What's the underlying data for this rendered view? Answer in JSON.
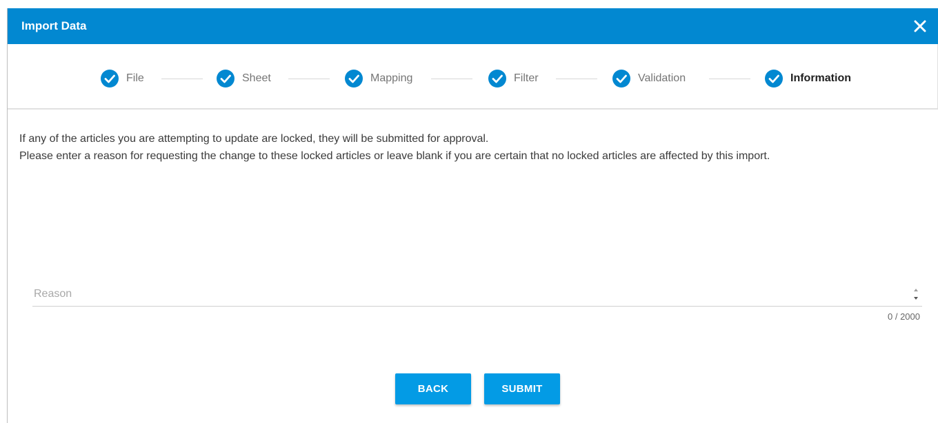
{
  "dialog": {
    "title": "Import Data"
  },
  "steps": [
    {
      "label": "File",
      "icon": "check-circle-icon",
      "state": "completed"
    },
    {
      "label": "Sheet",
      "icon": "check-circle-icon",
      "state": "completed"
    },
    {
      "label": "Mapping",
      "icon": "check-circle-icon",
      "state": "completed"
    },
    {
      "label": "Filter",
      "icon": "check-circle-icon",
      "state": "completed"
    },
    {
      "label": "Validation",
      "icon": "check-circle-icon",
      "state": "completed"
    },
    {
      "label": "Information",
      "icon": "check-circle-icon",
      "state": "active"
    }
  ],
  "content": {
    "line1": "If any of the articles you are attempting to update are locked, they will be submitted for approval.",
    "line2": "Please enter a reason for requesting the change to these locked articles or leave blank if you are certain that no locked articles are affected by this import."
  },
  "reason": {
    "placeholder": "Reason",
    "value": "",
    "counter": "0 / 2000"
  },
  "buttons": {
    "back": "BACK",
    "submit": "SUBMIT"
  },
  "colors": {
    "header": "#0288d1",
    "accent": "#039be5"
  }
}
